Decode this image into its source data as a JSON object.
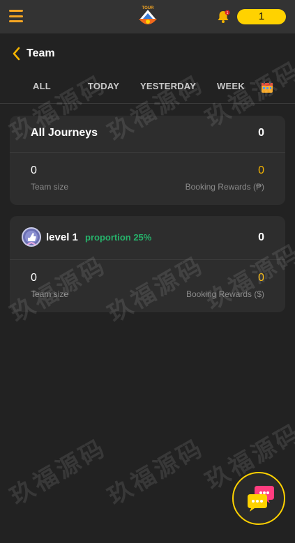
{
  "header": {
    "balance": "1",
    "notification_count": "1"
  },
  "page": {
    "title": "Team"
  },
  "tabs": [
    "ALL",
    "TODAY",
    "YESTERDAY",
    "WEEK"
  ],
  "all_card": {
    "title": "All Journeys",
    "total": "0",
    "team_size_value": "0",
    "team_size_label": "Team size",
    "rewards_value": "0",
    "rewards_label": "Booking Rewards (₱)"
  },
  "level_card": {
    "title": "level 1",
    "proportion": "proportion 25%",
    "total": "0",
    "team_size_value": "0",
    "team_size_label": "Team size",
    "rewards_value": "0",
    "rewards_label": "Booking Rewards ($)"
  },
  "watermark": "玖福源码",
  "colors": {
    "accent": "#ffd200",
    "orange": "#f5a623",
    "green": "#26b36b",
    "background": "#222222",
    "card": "#2d2d2d"
  }
}
